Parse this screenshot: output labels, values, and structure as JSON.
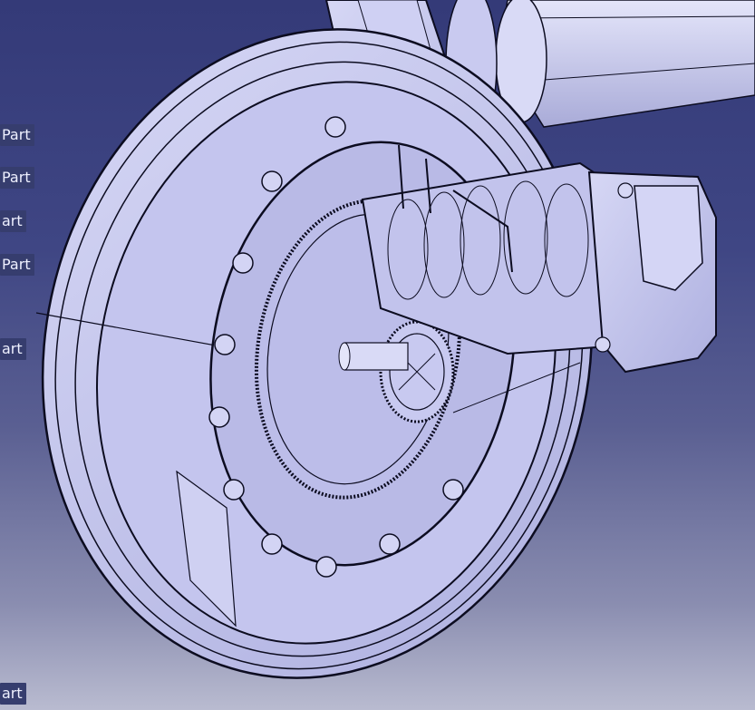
{
  "tree_labels": [
    {
      "text": "Part"
    },
    {
      "text": "Part"
    },
    {
      "text": "art"
    },
    {
      "text": "Part"
    },
    {
      "text": "art"
    },
    {
      "text": "art"
    }
  ],
  "colors": {
    "background_top": "#343a78",
    "background_bottom": "#b9bbd0",
    "part_fill": "#c6c7ef",
    "edge_line": "#0c0c20",
    "label_background": "#363d6e"
  }
}
